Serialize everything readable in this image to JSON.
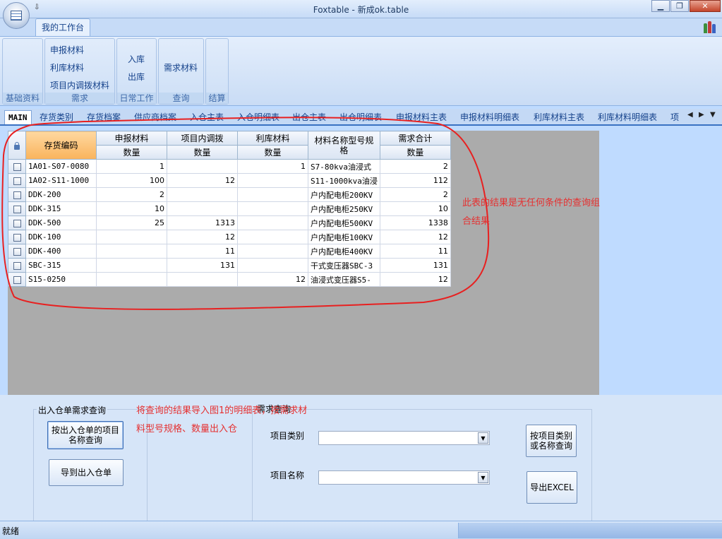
{
  "window": {
    "title": "Foxtable - 新成ok.table",
    "qat_symbol": "⇩"
  },
  "ribbon": {
    "tab": "我的工作台",
    "groups": [
      {
        "label": "基础资料",
        "items": []
      },
      {
        "label": "需求",
        "items": [
          "申报材料",
          "利库材料",
          "项目内调拨材料"
        ]
      },
      {
        "label": "日常工作",
        "items": [
          "入库",
          "出库"
        ]
      },
      {
        "label": "查询",
        "items": [
          "需求材料"
        ]
      },
      {
        "label": "结算",
        "items": []
      }
    ]
  },
  "sheet_tabs": [
    "MAIN",
    "存货类别",
    "存货档案",
    "供应商档案",
    "入仓主表",
    "入仓明细表",
    "出仓主表",
    "出仓明细表",
    "申报材料主表",
    "申报材料明细表",
    "利库材料主表",
    "利库材料明细表",
    "项"
  ],
  "grid": {
    "headers_top": [
      "存货编码",
      "申报材料",
      "项目内调拨",
      "利库材料",
      "材料名称型号规格",
      "需求合计"
    ],
    "headers_sub": [
      "数量",
      "数量",
      "数量",
      "数量"
    ],
    "rows": [
      [
        "1A01-S07-0080",
        "1",
        "",
        "1",
        "S7-80kva油浸式",
        "2"
      ],
      [
        "1A02-S11-1000",
        "100",
        "12",
        "",
        "S11-1000kva油浸",
        "112"
      ],
      [
        "DDK-200",
        "2",
        "",
        "",
        "户内配电柜200KV",
        "2"
      ],
      [
        "DDK-315",
        "10",
        "",
        "",
        "户内配电柜250KV",
        "10"
      ],
      [
        "DDK-500",
        "25",
        "1313",
        "",
        "户内配电柜500KV",
        "1338"
      ],
      [
        "DDK-100",
        "",
        "12",
        "",
        "户内配电柜100KV",
        "12"
      ],
      [
        "DDK-400",
        "",
        "11",
        "",
        "户内配电柜400KV",
        "11"
      ],
      [
        "SBC-315",
        "",
        "131",
        "",
        "干式变压器SBC-3",
        "131"
      ],
      [
        "S15-0250",
        "",
        "",
        "12",
        "油浸式变压器S5-",
        "12"
      ]
    ]
  },
  "annotations": {
    "note1": "此表的结果是无任何条件的查询组合结果",
    "note2": "将查询的结果导入图1的明细表，按需求材料型号规格、数量出入仓"
  },
  "bottom": {
    "frame1_title": "出入仓单需求查询",
    "btn_query_by_project": "按出入仓单的项目名称查询",
    "btn_export_to_order": "导到出入仓单",
    "frame2_title": "需求查询",
    "label_category": "项目类别",
    "label_name": "项目名称",
    "combo_category_value": "",
    "combo_name_value": "",
    "btn_query_by_category": "按项目类别或名称查询",
    "btn_export_excel": "导出EXCEL"
  },
  "status": {
    "text": "就绪"
  },
  "colors": {
    "annotation_red": "#e53030",
    "selected_header": "#f9b35c"
  }
}
